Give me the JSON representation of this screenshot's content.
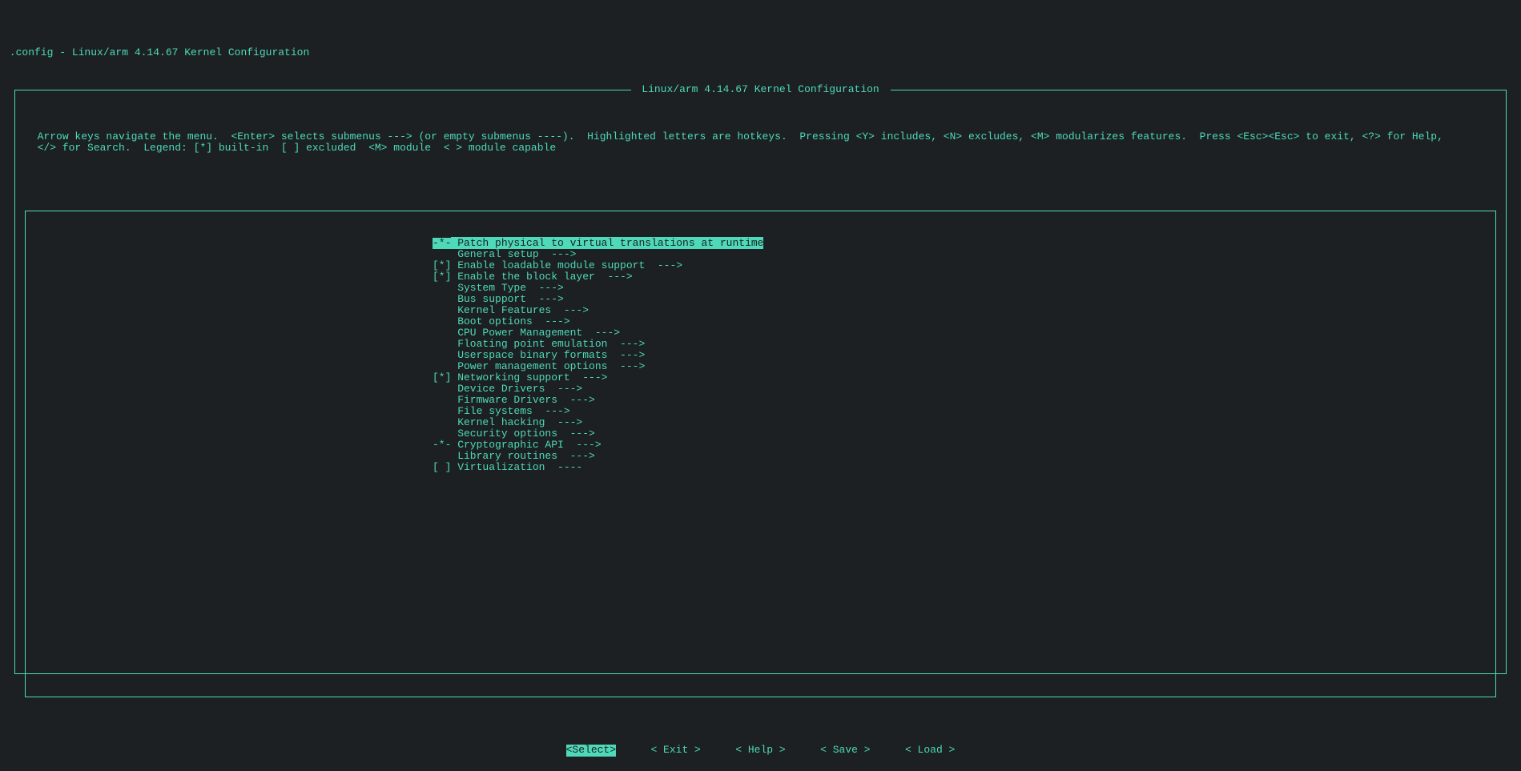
{
  "title_line": " .config - Linux/arm 4.14.67 Kernel Configuration",
  "box_title": " Linux/arm 4.14.67 Kernel Configuration ",
  "help_text": "  Arrow keys navigate the menu.  <Enter> selects submenus ---> (or empty submenus ----).  Highlighted letters are hotkeys.  Pressing <Y> includes, <N> excludes, <M> modularizes features.  Press <Esc><Esc> to exit, <?> for Help,\n  </> for Search.  Legend: [*] built-in  [ ] excluded  <M> module  < > module capable",
  "menu_items": [
    {
      "mark": "-*-",
      "label": " Patch physical to virtual translations at runtime",
      "selected": true
    },
    {
      "mark": "   ",
      "label": " General setup  --->"
    },
    {
      "mark": "[*]",
      "label": " Enable loadable module support  --->"
    },
    {
      "mark": "[*]",
      "label": " Enable the block layer  --->"
    },
    {
      "mark": "   ",
      "label": " System Type  --->"
    },
    {
      "mark": "   ",
      "label": " Bus support  --->"
    },
    {
      "mark": "   ",
      "label": " Kernel Features  --->"
    },
    {
      "mark": "   ",
      "label": " Boot options  --->"
    },
    {
      "mark": "   ",
      "label": " CPU Power Management  --->"
    },
    {
      "mark": "   ",
      "label": " Floating point emulation  --->"
    },
    {
      "mark": "   ",
      "label": " Userspace binary formats  --->"
    },
    {
      "mark": "   ",
      "label": " Power management options  --->"
    },
    {
      "mark": "[*]",
      "label": " Networking support  --->"
    },
    {
      "mark": "   ",
      "label": " Device Drivers  --->"
    },
    {
      "mark": "   ",
      "label": " Firmware Drivers  --->"
    },
    {
      "mark": "   ",
      "label": " File systems  --->"
    },
    {
      "mark": "   ",
      "label": " Kernel hacking  --->"
    },
    {
      "mark": "   ",
      "label": " Security options  --->"
    },
    {
      "mark": "-*-",
      "label": " Cryptographic API  --->"
    },
    {
      "mark": "   ",
      "label": " Library routines  --->"
    },
    {
      "mark": "[ ]",
      "label": " Virtualization  ----"
    }
  ],
  "buttons": [
    {
      "label": "<Select>",
      "selected": true
    },
    {
      "label": "< Exit >"
    },
    {
      "label": "< Help >"
    },
    {
      "label": "< Save >"
    },
    {
      "label": "< Load >"
    }
  ]
}
